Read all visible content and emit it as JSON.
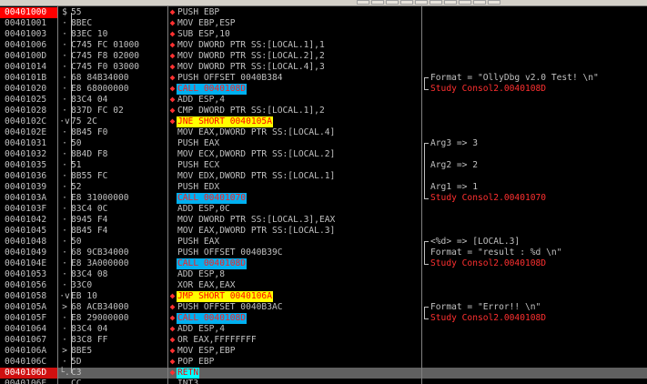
{
  "rows": [
    {
      "addr": "00401000",
      "mark": "$",
      "hex": "55",
      "dot": "◆",
      "ins": "PUSH EBP",
      "kind": "",
      "cmt": ""
    },
    {
      "addr": "00401001",
      "mark": "·",
      "hex": "8BEC",
      "dot": "◆",
      "ins": "MOV EBP,ESP",
      "kind": "",
      "cmt": ""
    },
    {
      "addr": "00401003",
      "mark": "·",
      "hex": "83EC 10",
      "dot": "◆",
      "ins": "SUB ESP,10",
      "kind": "",
      "cmt": ""
    },
    {
      "addr": "00401006",
      "mark": "·",
      "hex": "C745 FC 01000",
      "dot": "◆",
      "ins": "MOV DWORD PTR SS:[LOCAL.1],1",
      "kind": "",
      "cmt": ""
    },
    {
      "addr": "0040100D",
      "mark": "·",
      "hex": "C745 F8 02000",
      "dot": "◆",
      "ins": "MOV DWORD PTR SS:[LOCAL.2],2",
      "kind": "",
      "cmt": ""
    },
    {
      "addr": "00401014",
      "mark": "·",
      "hex": "C745 F0 03000",
      "dot": "◆",
      "ins": "MOV DWORD PTR SS:[LOCAL.4],3",
      "kind": "",
      "cmt": ""
    },
    {
      "addr": "0040101B",
      "mark": "·",
      "hex": "68 84B34000",
      "dot": "◆",
      "ins": "PUSH OFFSET 0040B384",
      "kind": "",
      "cmt": "Format = \"OllyDbg v2.0 Test! \\n\""
    },
    {
      "addr": "00401020",
      "mark": "·",
      "hex": "E8 68000000",
      "dot": "◆",
      "ins": "CALL 0040108D",
      "kind": "call",
      "cmt": "Study Consol2.0040108D",
      "cmtRed": true
    },
    {
      "addr": "00401025",
      "mark": "·",
      "hex": "83C4 04",
      "dot": "◆",
      "ins": "ADD ESP,4",
      "kind": "",
      "cmt": ""
    },
    {
      "addr": "00401028",
      "mark": "·",
      "hex": "837D FC 02",
      "dot": "◆",
      "ins": "CMP DWORD PTR SS:[LOCAL.1],2",
      "kind": "",
      "cmt": ""
    },
    {
      "addr": "0040102C",
      "mark": "·v",
      "hex": "75 2C",
      "dot": "◆",
      "ins": "JNE SHORT 0040105A",
      "kind": "jmp",
      "cmt": ""
    },
    {
      "addr": "0040102E",
      "mark": "·",
      "hex": "8B45 F0",
      "dot": "",
      "ins": "MOV EAX,DWORD PTR SS:[LOCAL.4]",
      "kind": "",
      "cmt": ""
    },
    {
      "addr": "00401031",
      "mark": "·",
      "hex": "50",
      "dot": "",
      "ins": "PUSH EAX",
      "kind": "",
      "cmt": "Arg3 => 3"
    },
    {
      "addr": "00401032",
      "mark": "·",
      "hex": "8B4D F8",
      "dot": "",
      "ins": "MOV ECX,DWORD PTR SS:[LOCAL.2]",
      "kind": "",
      "cmt": ""
    },
    {
      "addr": "00401035",
      "mark": "·",
      "hex": "51",
      "dot": "",
      "ins": "PUSH ECX",
      "kind": "",
      "cmt": "Arg2 => 2"
    },
    {
      "addr": "00401036",
      "mark": "·",
      "hex": "8B55 FC",
      "dot": "",
      "ins": "MOV EDX,DWORD PTR SS:[LOCAL.1]",
      "kind": "",
      "cmt": ""
    },
    {
      "addr": "00401039",
      "mark": "·",
      "hex": "52",
      "dot": "",
      "ins": "PUSH EDX",
      "kind": "",
      "cmt": "Arg1 => 1"
    },
    {
      "addr": "0040103A",
      "mark": "·",
      "hex": "E8 31000000",
      "dot": "",
      "ins": "CALL 00401070",
      "kind": "call",
      "cmt": "Study Consol2.00401070",
      "cmtRed": true
    },
    {
      "addr": "0040103F",
      "mark": "·",
      "hex": "83C4 0C",
      "dot": "",
      "ins": "ADD ESP,0C",
      "kind": "",
      "cmt": ""
    },
    {
      "addr": "00401042",
      "mark": "·",
      "hex": "8945 F4",
      "dot": "",
      "ins": "MOV DWORD PTR SS:[LOCAL.3],EAX",
      "kind": "",
      "cmt": ""
    },
    {
      "addr": "00401045",
      "mark": "·",
      "hex": "8B45 F4",
      "dot": "",
      "ins": "MOV EAX,DWORD PTR SS:[LOCAL.3]",
      "kind": "",
      "cmt": ""
    },
    {
      "addr": "00401048",
      "mark": "·",
      "hex": "50",
      "dot": "",
      "ins": "PUSH EAX",
      "kind": "",
      "cmt": "<%d> => [LOCAL.3]"
    },
    {
      "addr": "00401049",
      "mark": "·",
      "hex": "68 9CB34000",
      "dot": "",
      "ins": "PUSH OFFSET 0040B39C",
      "kind": "",
      "cmt": "Format = \"result : %d \\n\""
    },
    {
      "addr": "0040104E",
      "mark": "·",
      "hex": "E8 3A000000",
      "dot": "",
      "ins": "CALL 0040108D",
      "kind": "call",
      "cmt": "Study Consol2.0040108D",
      "cmtRed": true
    },
    {
      "addr": "00401053",
      "mark": "·",
      "hex": "83C4 08",
      "dot": "",
      "ins": "ADD ESP,8",
      "kind": "",
      "cmt": ""
    },
    {
      "addr": "00401056",
      "mark": "·",
      "hex": "33C0",
      "dot": "",
      "ins": "XOR EAX,EAX",
      "kind": "",
      "cmt": ""
    },
    {
      "addr": "00401058",
      "mark": "·v",
      "hex": "EB 10",
      "dot": "◆",
      "ins": "JMP SHORT 0040106A",
      "kind": "jmp",
      "cmt": ""
    },
    {
      "addr": "0040105A",
      "mark": ">",
      "hex": "68 ACB34000",
      "dot": "◆",
      "ins": "PUSH OFFSET 0040B3AC",
      "kind": "",
      "cmt": "Format = \"Error!! \\n\""
    },
    {
      "addr": "0040105F",
      "mark": "·",
      "hex": "E8 29000000",
      "dot": "◆",
      "ins": "CALL 0040108D",
      "kind": "call",
      "cmt": "Study Consol2.0040108D",
      "cmtRed": true
    },
    {
      "addr": "00401064",
      "mark": "·",
      "hex": "83C4 04",
      "dot": "◆",
      "ins": "ADD ESP,4",
      "kind": "",
      "cmt": ""
    },
    {
      "addr": "00401067",
      "mark": "·",
      "hex": "83C8 FF",
      "dot": "◆",
      "ins": "OR EAX,FFFFFFFF",
      "kind": "",
      "cmt": ""
    },
    {
      "addr": "0040106A",
      "mark": ">",
      "hex": "8BE5",
      "dot": "◆",
      "ins": "MOV ESP,EBP",
      "kind": "",
      "cmt": ""
    },
    {
      "addr": "0040106C",
      "mark": "·",
      "hex": "5D",
      "dot": "◆",
      "ins": "POP EBP",
      "kind": "",
      "cmt": ""
    },
    {
      "addr": "0040106D",
      "mark": "└.",
      "hex": "C3",
      "dot": "◆",
      "ins": "RETN",
      "kind": "retn",
      "cmt": "",
      "selected": true
    },
    {
      "addr": "0040106E",
      "mark": "",
      "hex": "CC",
      "dot": "",
      "ins": "INT3",
      "kind": "",
      "cmt": ""
    }
  ]
}
